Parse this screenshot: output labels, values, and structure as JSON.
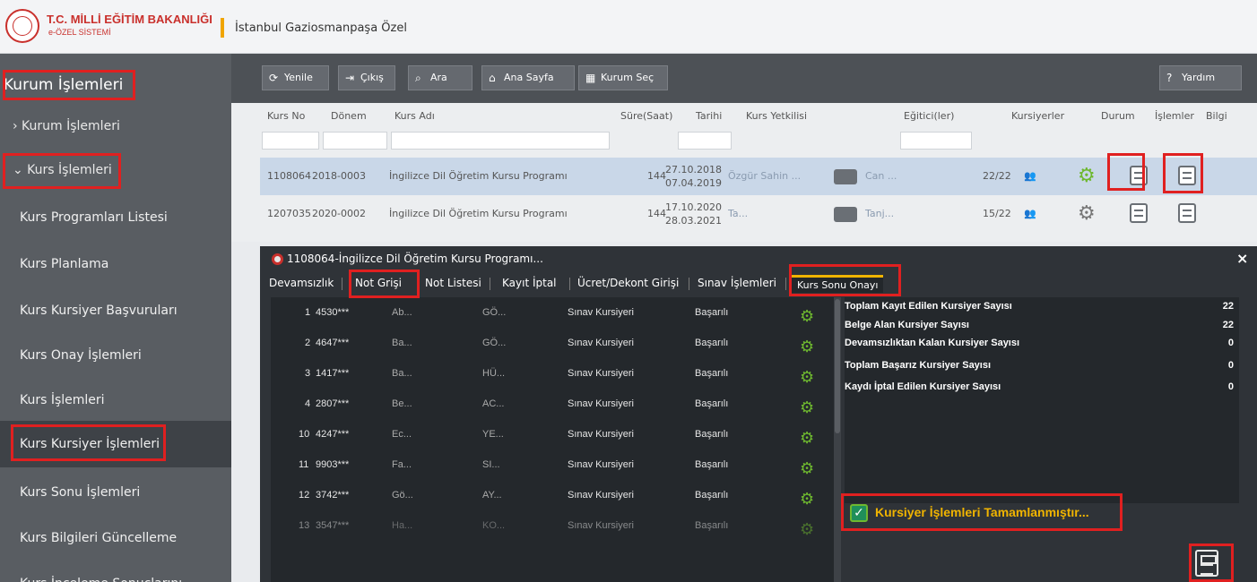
{
  "header": {
    "ministry_title": "T.C. MİLLİ EĞİTİM BAKANLIĞI",
    "ministry_sub": "e-ÖZEL SİSTEMİ",
    "institution": "İstanbul Gaziosmanpaşa Özel"
  },
  "sidebar": {
    "title": "Kurum İşlemleri",
    "items": [
      "› Kurum İşlemleri",
      "⌄ Kurs İşlemleri",
      "Kurs Programları Listesi",
      "Kurs Planlama",
      "Kurs Kursiyer Başvuruları",
      "Kurs Onay İşlemleri",
      "Kurs İşlemleri",
      "Kurs Kursiyer İşlemleri",
      "Kurs Sonu İşlemleri",
      "Kurs Bilgileri Güncelleme",
      "Kurs İnceleme Sonuçlarını"
    ]
  },
  "toolbar": {
    "refresh": "Yenile",
    "exit": "Çıkış",
    "search": "Ara",
    "home": "Ana Sayfa",
    "select_institution": "Kurum Seç",
    "help": "Yardım"
  },
  "table": {
    "columns": [
      "Kurs No",
      "Dönem",
      "Kurs Adı",
      "Süre(Saat)",
      "Tarihi",
      "Kurs Yetkilisi",
      "Eğitici(ler)",
      "Kursiyerler",
      "Durum",
      "İşlemler",
      "Bilgi"
    ],
    "rows": [
      {
        "no": "1108064",
        "period": "2018-0003",
        "name": "İngilizce Dil Öğretim Kursu Programı",
        "hours": "144",
        "date_start": "27.10.2018",
        "date_end": "07.04.2019",
        "manager": "Özgür Sahin ...",
        "trainer": "Can ...",
        "students": "22/22"
      },
      {
        "no": "1207035",
        "period": "2020-0002",
        "name": "İngilizce Dil Öğretim Kursu Programı",
        "hours": "144",
        "date_start": "17.10.2020",
        "date_end": "28.03.2021",
        "manager": "Ta...",
        "trainer": "Tanj...",
        "students": "15/22"
      }
    ]
  },
  "modal": {
    "title": "1108064-İngilizce Dil Öğretim Kursu Programı...",
    "close": "×",
    "tabs": [
      "Devamsızlık",
      "Not Grişi",
      "Not Listesi",
      "Kayıt İptal",
      "Ücret/Dekont Girişi",
      "Sınav İşlemleri",
      "Kurs Sonu Onayı"
    ],
    "students": [
      {
        "seq": "1",
        "id": "4530***",
        "first": "Ab...",
        "last": "GÖ...",
        "type": "Sınav Kursiyeri",
        "result": "Başarılı"
      },
      {
        "seq": "2",
        "id": "4647***",
        "first": "Ba...",
        "last": "GÖ...",
        "type": "Sınav Kursiyeri",
        "result": "Başarılı"
      },
      {
        "seq": "3",
        "id": "1417***",
        "first": "Ba...",
        "last": "HÜ...",
        "type": "Sınav Kursiyeri",
        "result": "Başarılı"
      },
      {
        "seq": "4",
        "id": "2807***",
        "first": "Be...",
        "last": "AC...",
        "type": "Sınav Kursiyeri",
        "result": "Başarılı"
      },
      {
        "seq": "10",
        "id": "4247***",
        "first": "Ec...",
        "last": "YE...",
        "type": "Sınav Kursiyeri",
        "result": "Başarılı"
      },
      {
        "seq": "11",
        "id": "9903***",
        "first": "Fa...",
        "last": "SI...",
        "type": "Sınav Kursiyeri",
        "result": "Başarılı"
      },
      {
        "seq": "12",
        "id": "3742***",
        "first": "Gö...",
        "last": "AY...",
        "type": "Sınav Kursiyeri",
        "result": "Başarılı"
      },
      {
        "seq": "13",
        "id": "3547***",
        "first": "Ha...",
        "last": "KO...",
        "type": "Sınav Kursiyeri",
        "result": "Başarılı"
      }
    ],
    "summary": [
      {
        "label": "Toplam Kayıt Edilen Kursiyer Sayısı",
        "value": "22"
      },
      {
        "label": "Belge Alan Kursiyer Sayısı",
        "value": "22"
      },
      {
        "label": "Devamsızlıktan Kalan Kursiyer Sayısı",
        "value": "0"
      },
      {
        "label": "Toplam Başarız Kursiyer Sayısı",
        "value": "0"
      },
      {
        "label": "Kaydı İptal Edilen Kursiyer Sayısı",
        "value": "0"
      }
    ],
    "complete_text": "Kursiyer İşlemleri Tamamlanmıştır..."
  },
  "colors": {
    "brand_red": "#c9302c",
    "accent_green": "#6eb82f",
    "warning_yellow": "#f0b400",
    "highlight_red": "#e02020"
  }
}
